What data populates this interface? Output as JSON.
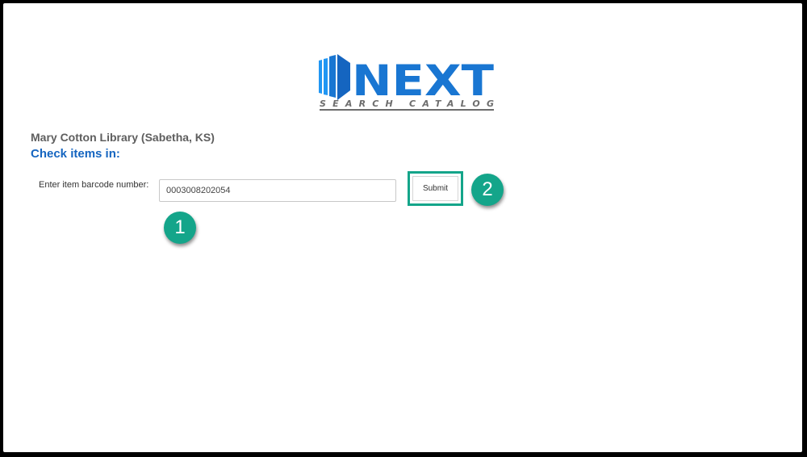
{
  "logo": {
    "wordmark": "NEXT",
    "tagline": "SEARCH CATALOG",
    "colors": {
      "primary_blue": "#1565c0",
      "light_blue": "#2196f3",
      "gray": "#6d6d6d"
    }
  },
  "library_name": "Mary Cotton Library (Sabetha, KS)",
  "page_heading": "Check items in:",
  "form": {
    "barcode_label": "Enter item barcode number:",
    "barcode_value": "0003008202054",
    "submit_label": "Submit"
  },
  "annotations": {
    "step1": "1",
    "step2": "2",
    "accent_color": "#14a58a"
  }
}
